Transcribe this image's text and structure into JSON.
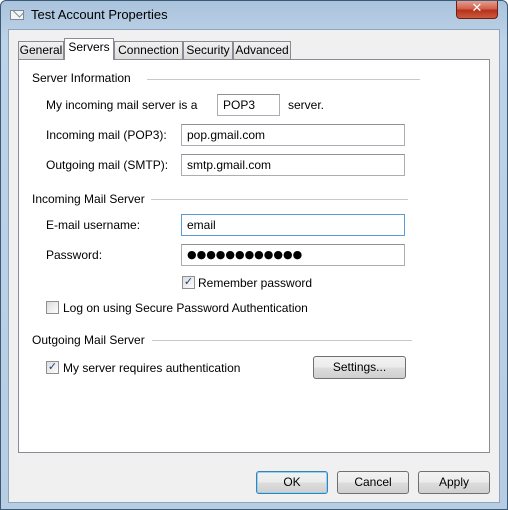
{
  "window": {
    "title": "Test Account Properties",
    "close_symbol": "✕"
  },
  "tabs": [
    {
      "label": "General"
    },
    {
      "label": "Servers"
    },
    {
      "label": "Connection"
    },
    {
      "label": "Security"
    },
    {
      "label": "Advanced"
    }
  ],
  "active_tab": "Servers",
  "server_info": {
    "heading": "Server Information",
    "incoming_type_prefix": "My incoming mail server is a",
    "incoming_type_value": "POP3",
    "incoming_type_suffix": "server.",
    "incoming_label": "Incoming mail (POP3):",
    "incoming_value": "pop.gmail.com",
    "outgoing_label": "Outgoing mail (SMTP):",
    "outgoing_value": "smtp.gmail.com"
  },
  "incoming_server": {
    "heading": "Incoming Mail Server",
    "username_label": "E-mail username:",
    "username_value": "email",
    "password_label": "Password:",
    "password_value": "●●●●●●●●●●●●",
    "remember_label": "Remember password",
    "remember_checked": true,
    "spa_label": "Log on using Secure Password Authentication",
    "spa_checked": false
  },
  "outgoing_server": {
    "heading": "Outgoing Mail Server",
    "auth_label": "My server requires authentication",
    "auth_checked": true,
    "settings_button": "Settings..."
  },
  "buttons": {
    "ok": "OK",
    "cancel": "Cancel",
    "apply": "Apply"
  },
  "check_mark": "✓"
}
